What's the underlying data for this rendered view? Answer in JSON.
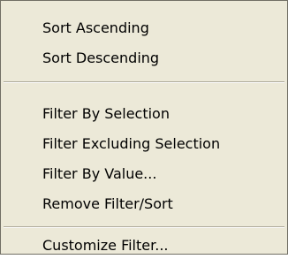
{
  "menu": {
    "items": [
      {
        "label": "Sort Ascending"
      },
      {
        "label": "Sort Descending"
      },
      {
        "label": "Filter By Selection"
      },
      {
        "label": "Filter Excluding Selection"
      },
      {
        "label": "Filter By Value..."
      },
      {
        "label": "Remove Filter/Sort"
      },
      {
        "label": "Customize Filter..."
      }
    ]
  }
}
